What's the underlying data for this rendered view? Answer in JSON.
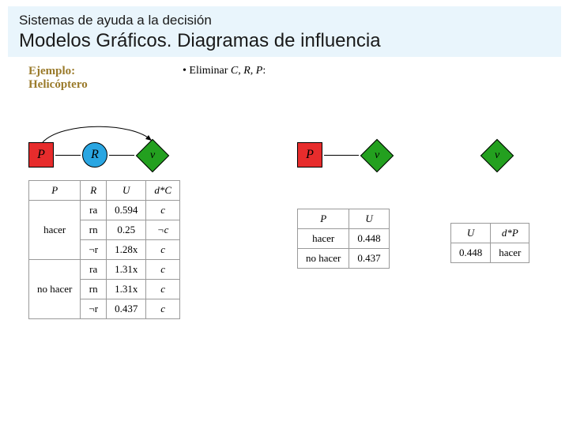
{
  "header": {
    "pre_title": "Sistemas de ayuda a la decisión",
    "main_title": "Modelos Gráficos. Diagramas de influencia"
  },
  "example": {
    "line1": "Ejemplo:",
    "line2": "Helicóptero"
  },
  "eliminate": {
    "bullet": "• Eliminar ",
    "vars": "C, R, P",
    "colon": ":"
  },
  "nodes": {
    "P": "P",
    "R": "R",
    "v": "v"
  },
  "table1": {
    "headers": [
      "P",
      "R",
      "U",
      "d*C"
    ],
    "rows": [
      {
        "P": "hacer",
        "R": "ra",
        "U": "0.594",
        "d": "c"
      },
      {
        "P": "",
        "R": "rn",
        "U": "0.25",
        "d": "¬c"
      },
      {
        "P": "",
        "R": "¬r",
        "U": "1.28x",
        "d": "c"
      },
      {
        "P": "no hacer",
        "R": "ra",
        "U": "1.31x",
        "d": "c"
      },
      {
        "P": "",
        "R": "rn",
        "U": "1.31x",
        "d": "c"
      },
      {
        "P": "",
        "R": "¬r",
        "U": "0.437",
        "d": "c"
      }
    ]
  },
  "table2": {
    "headers": [
      "P",
      "U"
    ],
    "rows": [
      {
        "P": "hacer",
        "U": "0.448"
      },
      {
        "P": "no hacer",
        "U": "0.437"
      }
    ]
  },
  "table3": {
    "headers": [
      "U",
      "d*P"
    ],
    "row": {
      "U": "0.448",
      "d": "hacer"
    }
  }
}
